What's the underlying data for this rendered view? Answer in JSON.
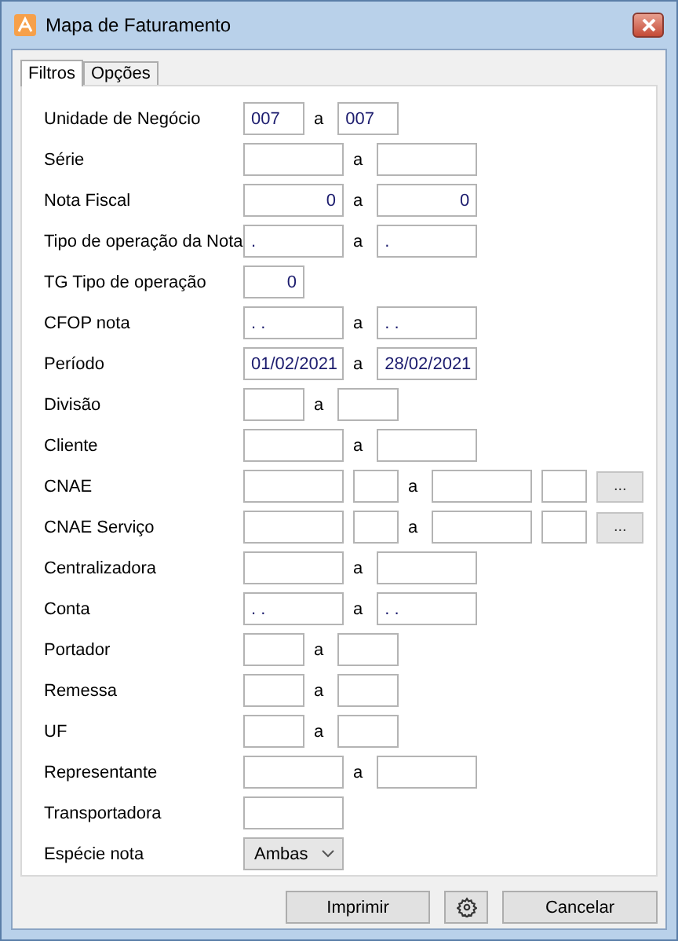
{
  "window": {
    "title": "Mapa de Faturamento"
  },
  "tabs": [
    {
      "label": "Filtros",
      "selected": true
    },
    {
      "label": "Opções",
      "selected": false
    }
  ],
  "rows": [
    {
      "label": "Unidade de Negócio",
      "items": [
        {
          "kind": "narrow",
          "value": "007"
        },
        {
          "kind": "sep",
          "text": "a"
        },
        {
          "kind": "narrow",
          "value": "007"
        }
      ]
    },
    {
      "label": "Série",
      "items": [
        {
          "kind": "wide"
        },
        {
          "kind": "sep",
          "text": "a"
        },
        {
          "kind": "wide"
        }
      ]
    },
    {
      "label": "Nota Fiscal",
      "items": [
        {
          "kind": "wide",
          "value": "0",
          "numeric": true
        },
        {
          "kind": "sep",
          "text": "a"
        },
        {
          "kind": "wide",
          "value": "0",
          "numeric": true
        }
      ]
    },
    {
      "label": "Tipo de operação da Nota",
      "items": [
        {
          "kind": "wide",
          "value": "."
        },
        {
          "kind": "sep",
          "text": "a"
        },
        {
          "kind": "wide",
          "value": "."
        }
      ]
    },
    {
      "label": "TG Tipo de operação",
      "items": [
        {
          "kind": "narrow",
          "value": "0",
          "numeric": true
        }
      ]
    },
    {
      "label": "CFOP nota",
      "items": [
        {
          "kind": "wide",
          "value": ". ."
        },
        {
          "kind": "sep",
          "text": "a"
        },
        {
          "kind": "wide",
          "value": ". ."
        }
      ]
    },
    {
      "label": "Período",
      "items": [
        {
          "kind": "wide",
          "value": "01/02/2021"
        },
        {
          "kind": "sep",
          "text": "a"
        },
        {
          "kind": "wide",
          "value": "28/02/2021"
        }
      ]
    },
    {
      "label": "Divisão",
      "items": [
        {
          "kind": "narrow"
        },
        {
          "kind": "sep",
          "text": "a"
        },
        {
          "kind": "narrow"
        }
      ]
    },
    {
      "label": "Cliente",
      "items": [
        {
          "kind": "wide"
        },
        {
          "kind": "sep",
          "text": "a"
        },
        {
          "kind": "wide"
        }
      ]
    },
    {
      "label": "CNAE",
      "items": [
        {
          "kind": "wide"
        },
        {
          "kind": "small"
        },
        {
          "kind": "sep",
          "text": "a"
        },
        {
          "kind": "wide"
        },
        {
          "kind": "small"
        },
        {
          "kind": "button",
          "text": "..."
        }
      ]
    },
    {
      "label": "CNAE Serviço",
      "items": [
        {
          "kind": "wide"
        },
        {
          "kind": "small"
        },
        {
          "kind": "sep",
          "text": "a"
        },
        {
          "kind": "wide"
        },
        {
          "kind": "small"
        },
        {
          "kind": "button",
          "text": "..."
        }
      ]
    },
    {
      "label": "Centralizadora",
      "items": [
        {
          "kind": "wide"
        },
        {
          "kind": "sep",
          "text": "a"
        },
        {
          "kind": "wide"
        }
      ]
    },
    {
      "label": "Conta",
      "items": [
        {
          "kind": "wide",
          "value": ". ."
        },
        {
          "kind": "sep",
          "text": "a"
        },
        {
          "kind": "wide",
          "value": ". ."
        }
      ]
    },
    {
      "label": "Portador",
      "items": [
        {
          "kind": "narrow"
        },
        {
          "kind": "sep",
          "text": "a"
        },
        {
          "kind": "narrow"
        }
      ]
    },
    {
      "label": "Remessa",
      "items": [
        {
          "kind": "narrow"
        },
        {
          "kind": "sep",
          "text": "a"
        },
        {
          "kind": "narrow"
        }
      ]
    },
    {
      "label": "UF",
      "items": [
        {
          "kind": "narrow"
        },
        {
          "kind": "sep",
          "text": "a"
        },
        {
          "kind": "narrow"
        }
      ]
    },
    {
      "label": "Representante",
      "items": [
        {
          "kind": "wide"
        },
        {
          "kind": "sep",
          "text": "a"
        },
        {
          "kind": "wide"
        }
      ]
    },
    {
      "label": "Transportadora",
      "items": [
        {
          "kind": "wide"
        }
      ]
    },
    {
      "label": "Espécie nota",
      "items": [
        {
          "kind": "select",
          "value": "Ambas"
        }
      ]
    }
  ],
  "buttons": [
    {
      "kind": "text",
      "label": "Imprimir"
    },
    {
      "kind": "gear"
    },
    {
      "kind": "text",
      "label": "Cancelar"
    }
  ]
}
